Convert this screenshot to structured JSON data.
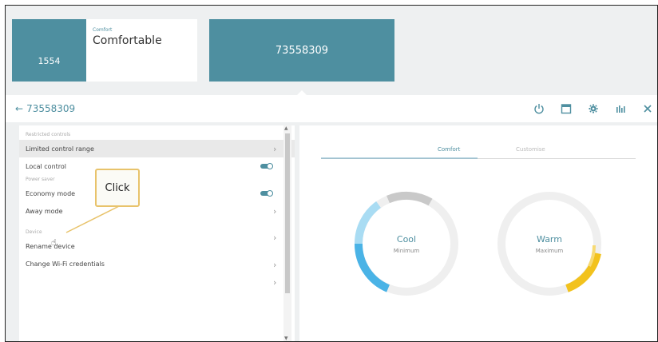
{
  "tiles": {
    "small_value": "1554",
    "comfort_label": "Comfort",
    "comfort_value": "Comfortable",
    "selected_value": "73558309"
  },
  "header": {
    "back_arrow": "←",
    "title": "73558309",
    "icons": [
      "power-icon",
      "calendar-icon",
      "gear-icon",
      "bar-chart-icon",
      "close-icon"
    ]
  },
  "settings": {
    "restricted_header": "Restricted controls",
    "limited_control_range": "Limited control range",
    "local_control": "Local control",
    "power_saver_header": "Power saver",
    "economy_mode": "Economy mode",
    "away_mode": "Away mode",
    "device_header": "Device",
    "rename_device": "Rename device",
    "change_wifi": "Change Wi-Fi credentials",
    "chevron": "›"
  },
  "tabs": {
    "comfort": "Comfort",
    "customise": "Customise"
  },
  "dials": {
    "cool_label": "Cool",
    "cool_sub": "Minimum",
    "warm_label": "Warm",
    "warm_sub": "Maximum",
    "cool_color": "#4ab3e6",
    "warm_color": "#f2c21d"
  },
  "callout": {
    "text": "Click"
  },
  "colors": {
    "accent": "#4e8fa0"
  }
}
